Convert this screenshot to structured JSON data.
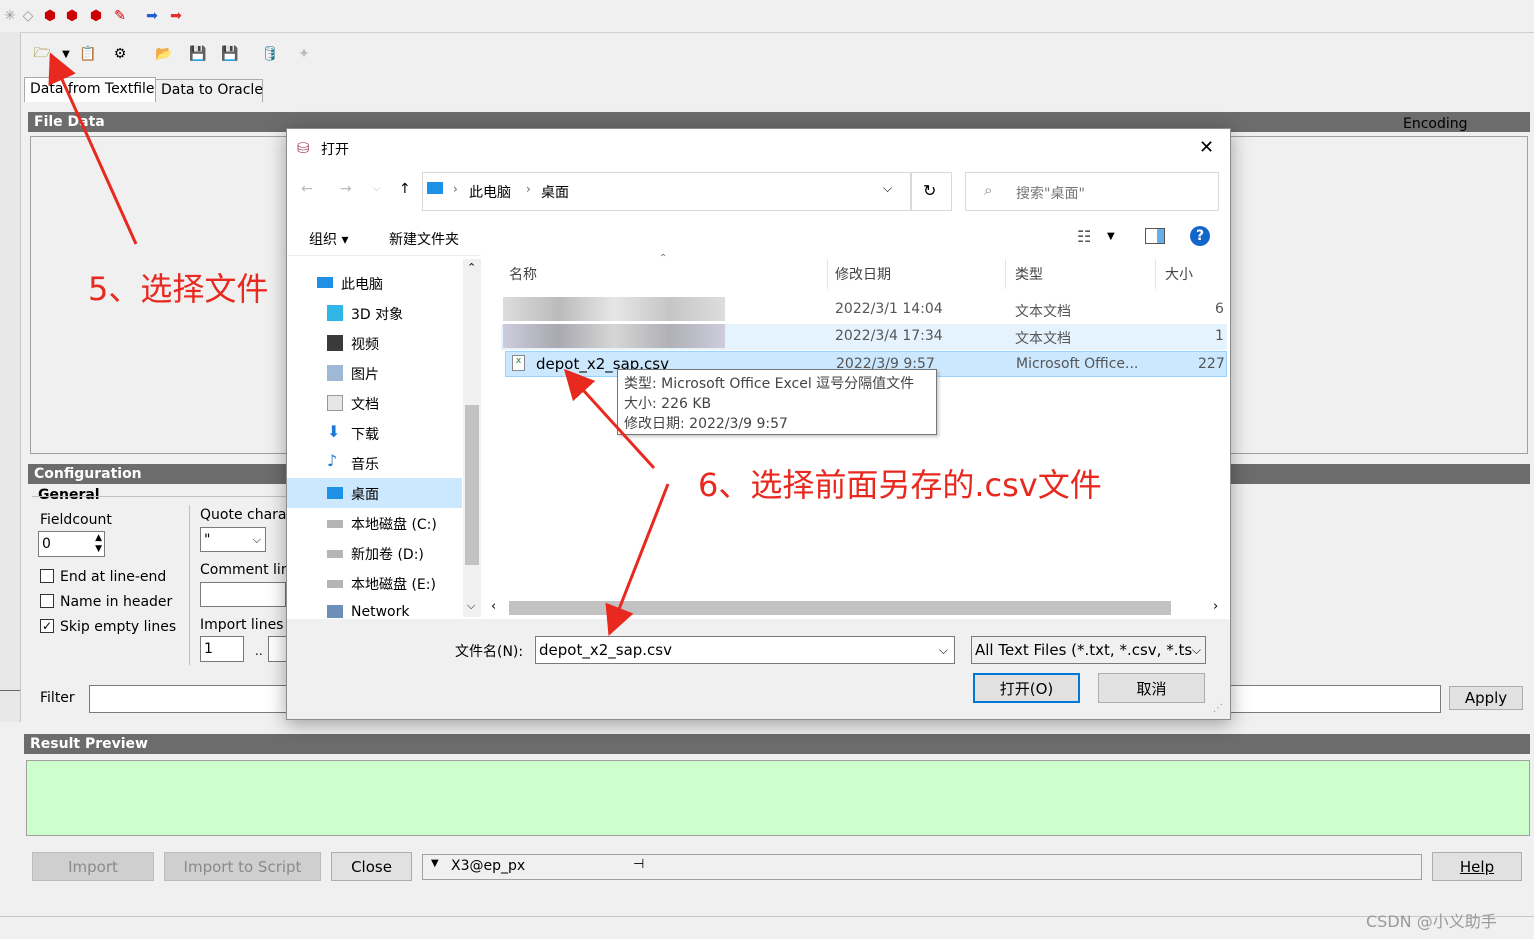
{
  "main_window": {
    "tabs": [
      "Data from Textfile",
      "Data to Oracle"
    ],
    "file_data_title": "File Data",
    "encoding_label": "Encoding",
    "config_title": "Configuration",
    "general_label": "General",
    "fieldcount_label": "Fieldcount",
    "fieldcount_value": "0",
    "end_at_line_end": "End at line-end",
    "name_in_header": "Name in header",
    "skip_empty_lines": "Skip empty lines",
    "quote_char_label": "Quote charac",
    "quote_char_value": "\"",
    "comment_label": "Comment lin",
    "import_lines_label": "Import lines",
    "import_lines_from": "1",
    "import_lines_sep": "..",
    "filter_label": "Filter",
    "apply_button": "Apply",
    "result_preview_title": "Result Preview",
    "import_button": "Import",
    "import_script_button": "Import to Script",
    "close_button": "Close",
    "connection": "X3@ep_px",
    "help_button": "Help"
  },
  "dialog": {
    "title": "打开",
    "breadcrumb": [
      "此电脑",
      "桌面"
    ],
    "search_placeholder": "搜索\"桌面\"",
    "organize": "组织 ▾",
    "new_folder": "新建文件夹",
    "nav_items": [
      "此电脑",
      "3D 对象",
      "视频",
      "图片",
      "文档",
      "下载",
      "音乐",
      "桌面",
      "本地磁盘 (C:)",
      "新加卷 (D:)",
      "本地磁盘 (E:)",
      "Network"
    ],
    "columns": [
      "名称",
      "修改日期",
      "类型",
      "大小"
    ],
    "files": [
      {
        "name": "",
        "date": "2022/3/1 14:04",
        "type": "文本文档",
        "size": "6"
      },
      {
        "name": "",
        "date": "2022/3/4 17:34",
        "type": "文本文档",
        "size": "1"
      },
      {
        "name": "depot_x2_sap.csv",
        "date": "2022/3/9 9:57",
        "type": "Microsoft Office...",
        "size": "227"
      }
    ],
    "tooltip": {
      "type": "类型: Microsoft Office Excel 逗号分隔值文件",
      "size": "大小: 226 KB",
      "date": "修改日期: 2022/3/9 9:57"
    },
    "filename_label": "文件名(N):",
    "filename_value": "depot_x2_sap.csv",
    "filetype_value": "All Text Files (*.txt, *.csv, *.tsv",
    "open_button": "打开(O)",
    "cancel_button": "取消"
  },
  "annotations": {
    "step5": "5、选择文件",
    "step6": "6、选择前面另存的.csv文件"
  },
  "watermark": "CSDN @小义助手",
  "colors": {
    "accent": "#0078d7",
    "annotation": "#e8291f",
    "preview_bg": "#ccffcc"
  }
}
